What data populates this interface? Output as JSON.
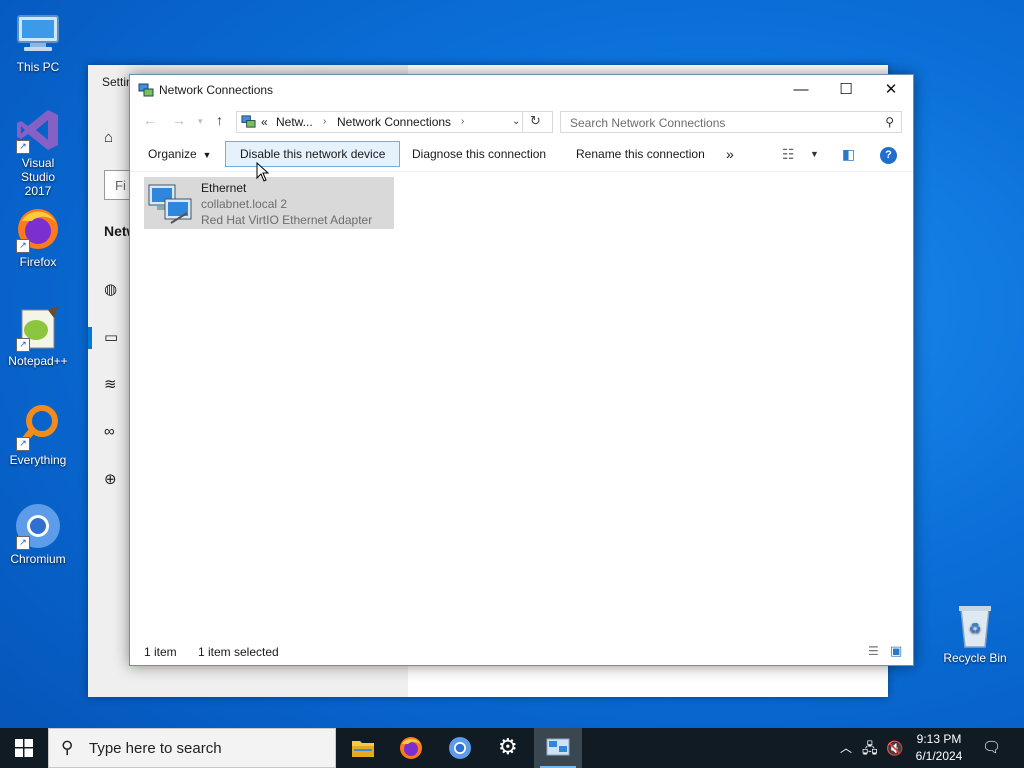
{
  "desktop": {
    "icons": [
      {
        "label": "This PC"
      },
      {
        "label": "Visual Studio 2017"
      },
      {
        "label": "Firefox"
      },
      {
        "label": "Notepad++"
      },
      {
        "label": "Everything"
      },
      {
        "label": "Chromium"
      },
      {
        "label": "Recycle Bin"
      }
    ]
  },
  "settings_window": {
    "title": "Settin",
    "search_placeholder": "Fi",
    "section": "Netw"
  },
  "nc_window": {
    "title": "Network Connections",
    "breadcrumb": {
      "prefix": "«",
      "item1": "Netw...",
      "item2": "Network Connections"
    },
    "search_placeholder": "Search Network Connections",
    "commands": {
      "organize": "Organize",
      "disable": "Disable this network device",
      "diagnose": "Diagnose this connection",
      "rename": "Rename this connection",
      "more": "»"
    },
    "item": {
      "name": "Ethernet",
      "network": "collabnet.local 2",
      "adapter": "Red Hat VirtIO Ethernet Adapter"
    },
    "status": {
      "count": "1 item",
      "selected": "1 item selected"
    }
  },
  "taskbar": {
    "search_placeholder": "Type here to search",
    "time": "9:13 PM",
    "date": "6/1/2024"
  },
  "colors": {
    "accent": "#0078d7",
    "taskbar": "#101b24",
    "hot_button": "#e5f1fb"
  }
}
